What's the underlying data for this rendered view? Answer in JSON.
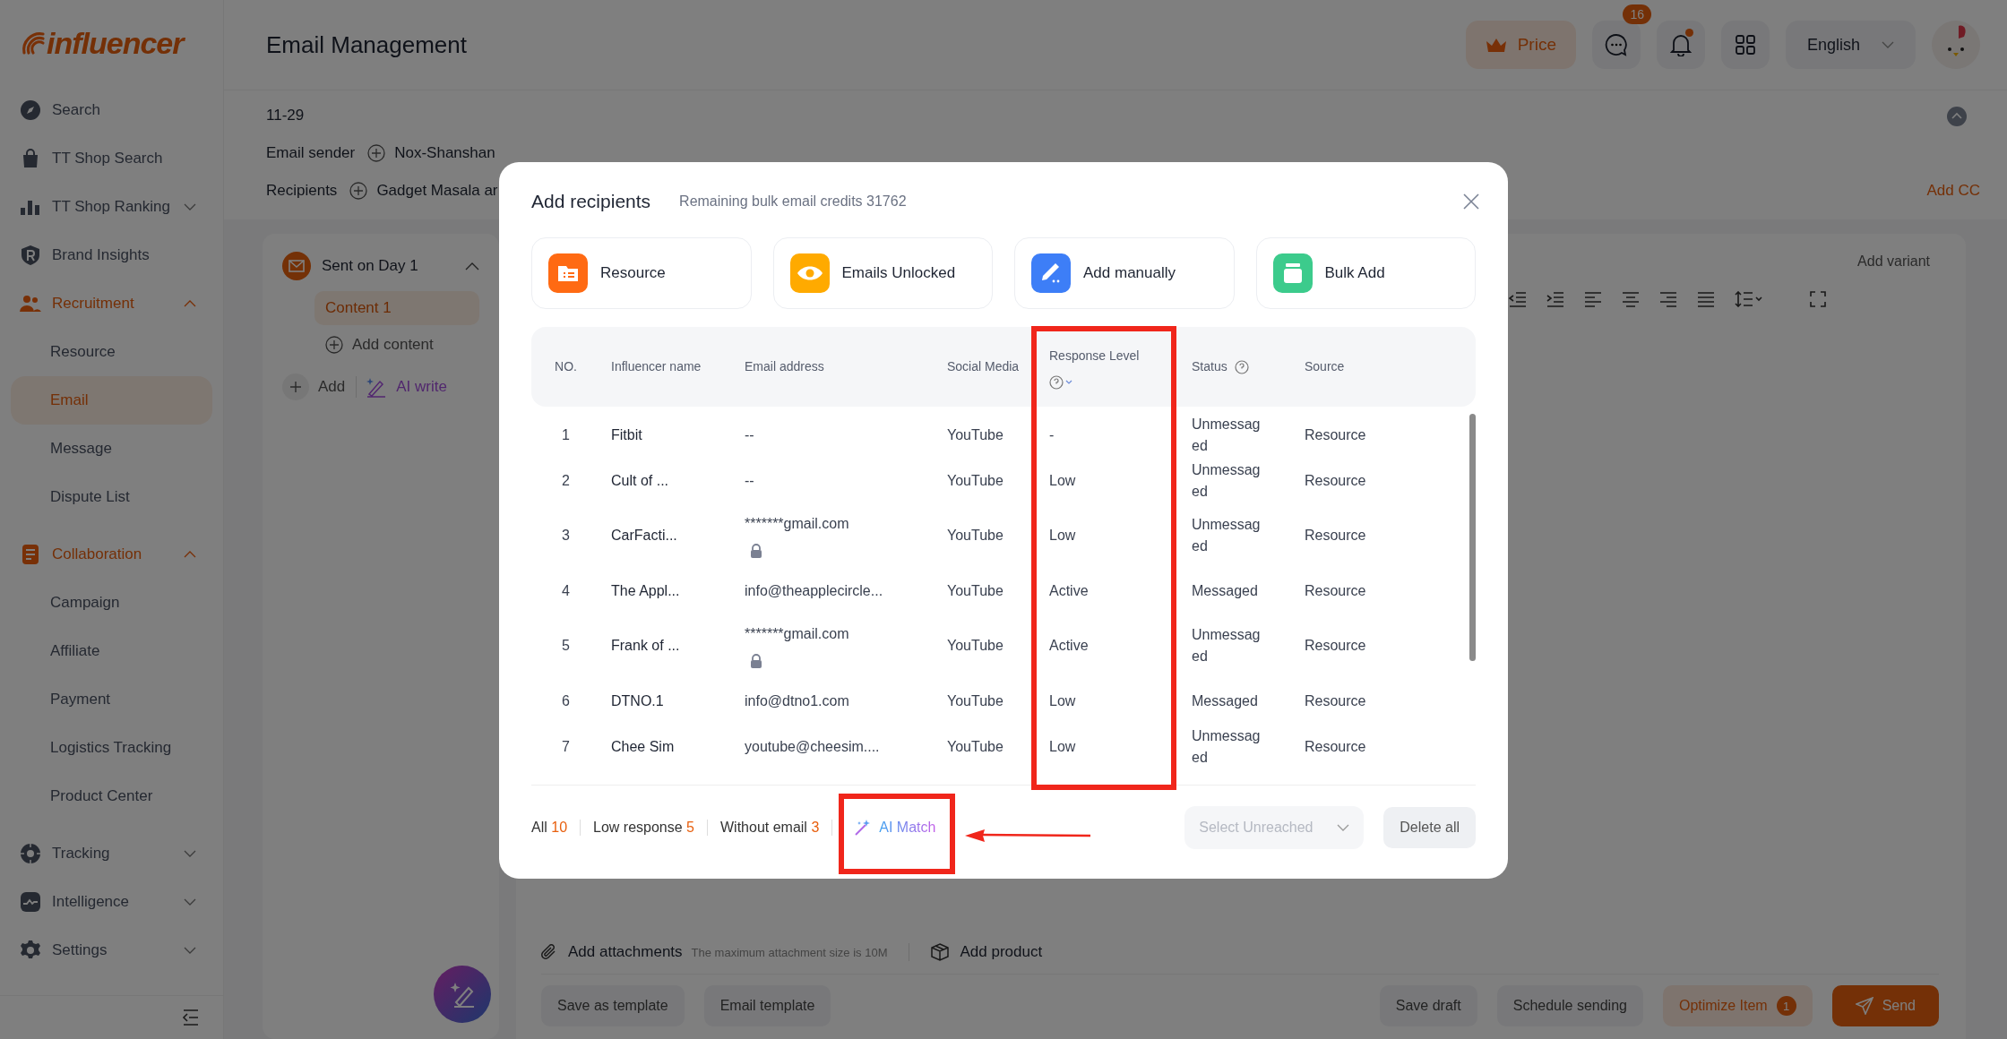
{
  "brand": {
    "logo": "influencer"
  },
  "sidebar": {
    "items": [
      {
        "label": "Search",
        "kind": "link",
        "active": false
      },
      {
        "label": "TT Shop Search",
        "kind": "link",
        "active": false
      },
      {
        "label": "TT Shop Ranking",
        "kind": "group",
        "active": false,
        "expanded": false
      },
      {
        "label": "Brand Insights",
        "kind": "link",
        "active": false
      },
      {
        "label": "Recruitment",
        "kind": "group",
        "active": true,
        "expanded": true,
        "children": [
          {
            "label": "Resource",
            "selected": false
          },
          {
            "label": "Email",
            "selected": true
          },
          {
            "label": "Message",
            "selected": false
          },
          {
            "label": "Dispute List",
            "selected": false
          }
        ]
      },
      {
        "label": "Collaboration",
        "kind": "group",
        "active": true,
        "expanded": true,
        "children": [
          {
            "label": "Campaign",
            "selected": false
          },
          {
            "label": "Affiliate",
            "selected": false
          },
          {
            "label": "Payment",
            "selected": false
          },
          {
            "label": "Logistics Tracking",
            "selected": false
          },
          {
            "label": "Product Center",
            "selected": false
          }
        ]
      },
      {
        "label": "Tracking",
        "kind": "group",
        "active": false,
        "expanded": false
      },
      {
        "label": "Intelligence",
        "kind": "group",
        "active": false,
        "expanded": false
      },
      {
        "label": "Settings",
        "kind": "group",
        "active": false,
        "expanded": false
      }
    ]
  },
  "header": {
    "title": "Email Management",
    "price": "Price",
    "messages_badge": "16",
    "notification_dot": true,
    "language": "English"
  },
  "composer": {
    "date": "11-29",
    "sender_label": "Email sender",
    "sender": "Nox-Shanshan",
    "recipients_label": "Recipients",
    "recipients": "Gadget Masala ar",
    "add_cc": "Add CC",
    "steps": [
      {
        "title": "Sent on Day 1",
        "expanded": true,
        "contents": [
          {
            "label": "Content 1",
            "selected": true
          }
        ]
      }
    ],
    "add_content": "Add content",
    "add": "Add",
    "ai_write": "AI write",
    "add_variant": "Add variant",
    "attachments": "Add attachments",
    "attachment_hint": "The maximum attachment size is 10M",
    "add_product": "Add product",
    "left_buttons": [
      "Save as template",
      "Email template"
    ],
    "right_buttons": [
      {
        "label": "Save draft",
        "kind": "plain"
      },
      {
        "label": "Schedule sending",
        "kind": "plain"
      },
      {
        "label": "Optimize Item",
        "kind": "optimize",
        "badge": "1"
      },
      {
        "label": "Send",
        "kind": "primary"
      }
    ]
  },
  "modal": {
    "title": "Add recipients",
    "credits": "Remaining bulk email credits 31762",
    "sources": [
      {
        "label": "Resource",
        "color": "#ff6a13"
      },
      {
        "label": "Emails Unlocked",
        "color": "#ffaa00"
      },
      {
        "label": "Add manually",
        "color": "#3d7ef7"
      },
      {
        "label": "Bulk Add",
        "color": "#3ccb8c"
      }
    ],
    "columns": [
      "NO.",
      "Influencer name",
      "Email address",
      "Social Media",
      "Response Level",
      "Status",
      "Source"
    ],
    "rows": [
      {
        "no": "1",
        "name": "Fitbit",
        "email": "--",
        "locked": false,
        "social": "YouTube",
        "response": "-",
        "status": "Unmessaged",
        "source": "Resource"
      },
      {
        "no": "2",
        "name": "Cult of ...",
        "email": "--",
        "locked": false,
        "social": "YouTube",
        "response": "Low",
        "status": "Unmessaged",
        "source": "Resource"
      },
      {
        "no": "3",
        "name": "CarFacti...",
        "email": "*******gmail.com",
        "locked": true,
        "social": "YouTube",
        "response": "Low",
        "status": "Unmessaged",
        "source": "Resource"
      },
      {
        "no": "4",
        "name": "The Appl...",
        "email": "info@theapplecircle...",
        "locked": false,
        "social": "YouTube",
        "response": "Active",
        "status": "Messaged",
        "source": "Resource"
      },
      {
        "no": "5",
        "name": "Frank of ...",
        "email": "*******gmail.com",
        "locked": true,
        "social": "YouTube",
        "response": "Active",
        "status": "Unmessaged",
        "source": "Resource"
      },
      {
        "no": "6",
        "name": "DTNO.1",
        "email": "info@dtno1.com",
        "locked": false,
        "social": "YouTube",
        "response": "Low",
        "status": "Messaged",
        "source": "Resource"
      },
      {
        "no": "7",
        "name": "Chee Sim",
        "email": "youtube@cheesim....",
        "locked": false,
        "social": "YouTube",
        "response": "Low",
        "status": "Unmessaged",
        "source": "Resource"
      }
    ],
    "filters": [
      {
        "label": "All",
        "count": "10"
      },
      {
        "label": "Low response",
        "count": "5"
      },
      {
        "label": "Without email",
        "count": "3"
      }
    ],
    "ai_match": "AI Match",
    "select_placeholder": "Select Unreached",
    "delete_all": "Delete all"
  }
}
